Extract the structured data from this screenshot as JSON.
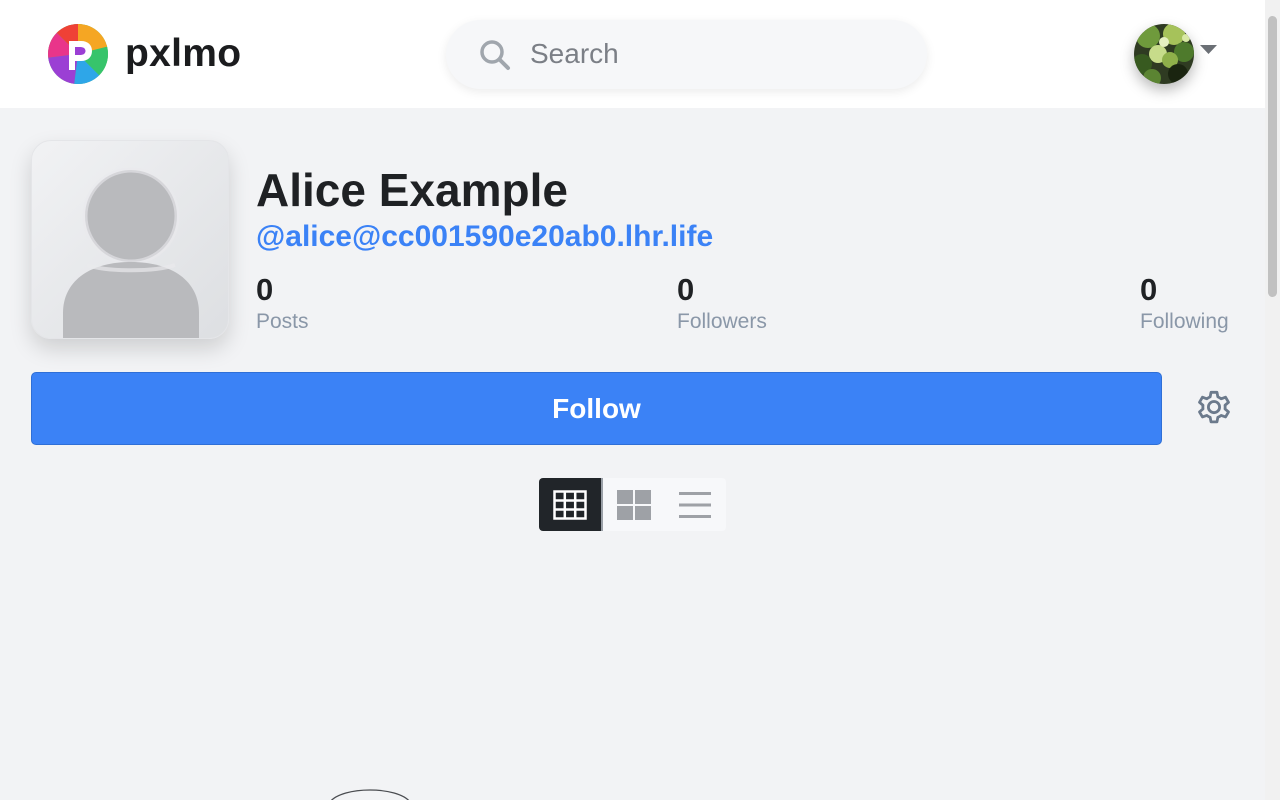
{
  "header": {
    "brand": "pxlmo",
    "search": {
      "placeholder": "Search",
      "value": ""
    },
    "user_menu": {
      "icon": "chevron-down-icon"
    }
  },
  "profile": {
    "name": "Alice Example",
    "handle": "@alice@cc001590e20ab0.lhr.life",
    "stats": [
      {
        "value": "0",
        "label": "Posts"
      },
      {
        "value": "0",
        "label": "Followers"
      },
      {
        "value": "0",
        "label": "Following"
      }
    ],
    "follow_label": "Follow",
    "settings_icon": "gear-icon"
  },
  "view_modes": [
    {
      "icon": "grid-3x3-icon",
      "active": true
    },
    {
      "icon": "grid-2x2-icon",
      "active": false
    },
    {
      "icon": "list-icon",
      "active": false
    }
  ],
  "colors": {
    "accent": "#3b82f6",
    "background": "#f2f3f5",
    "active_toggle": "#212529",
    "muted_text": "#8a97a8"
  }
}
